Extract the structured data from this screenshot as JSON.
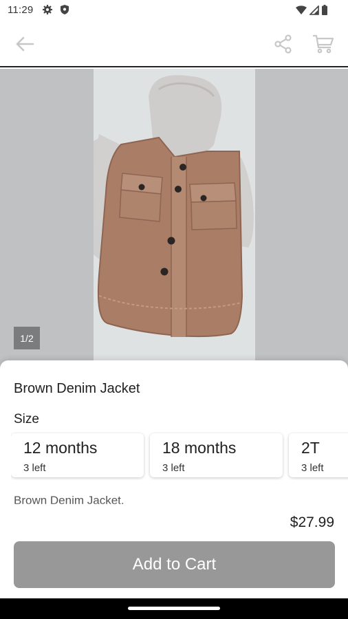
{
  "status_bar": {
    "time": "11:29",
    "left_icons": [
      "gear-icon",
      "shield-icon"
    ],
    "right_icons": [
      "wifi-icon",
      "signal-icon",
      "battery-icon"
    ]
  },
  "app_bar": {
    "icons": [
      "back-arrow-icon",
      "share-icon",
      "cart-icon"
    ],
    "icon_color": "#c7c7c7"
  },
  "gallery": {
    "page_indicator": "1/2",
    "current_image": 1,
    "total_images": 2
  },
  "product": {
    "title": "Brown Denim Jacket",
    "size_label": "Size",
    "sizes": [
      {
        "name": "12 months",
        "stock": "3 left"
      },
      {
        "name": "18 months",
        "stock": "3 left"
      },
      {
        "name": "2T",
        "stock": "3 left"
      }
    ],
    "description": "Brown Denim Jacket.",
    "price": "$27.99",
    "add_to_cart_label": "Add to Cart"
  },
  "colors": {
    "button_disabled": "#989898",
    "gallery_bg": "#bfc1c3"
  }
}
